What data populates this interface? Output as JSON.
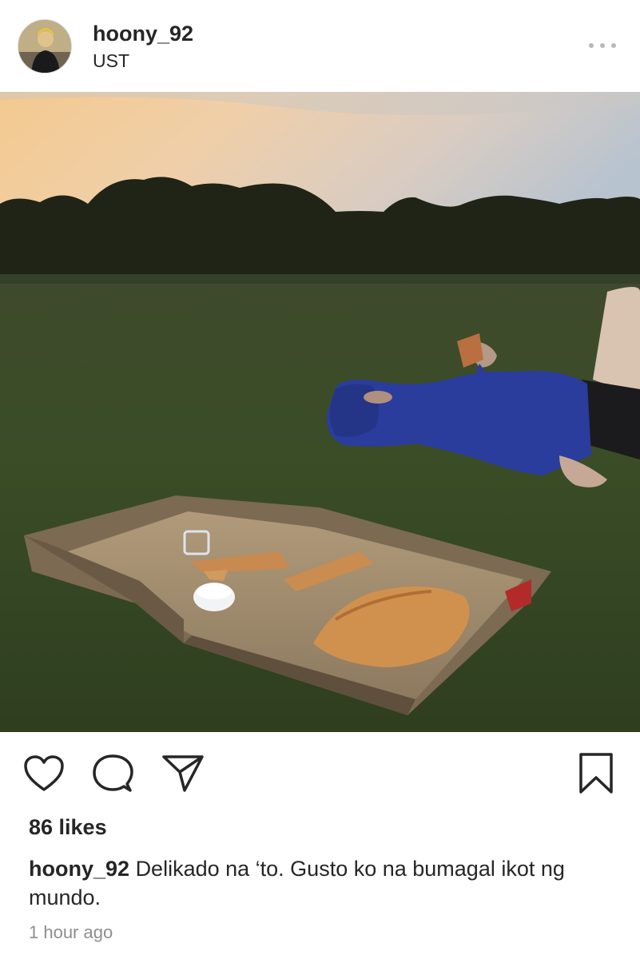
{
  "post": {
    "username": "hoony_92",
    "location": "UST",
    "likes": "86 likes",
    "caption_user": "hoony_92",
    "caption_text": "Delikado na ‘to. Gusto ko na bumagal ikot ng mundo.",
    "time": "1 hour ago"
  },
  "icons": {
    "header": [
      "more-options-icon"
    ],
    "actions": [
      "heart-icon",
      "comment-icon",
      "share-icon",
      "bookmark-icon"
    ]
  },
  "colors": {
    "text": "#262626",
    "muted": "#8e8e8e"
  }
}
